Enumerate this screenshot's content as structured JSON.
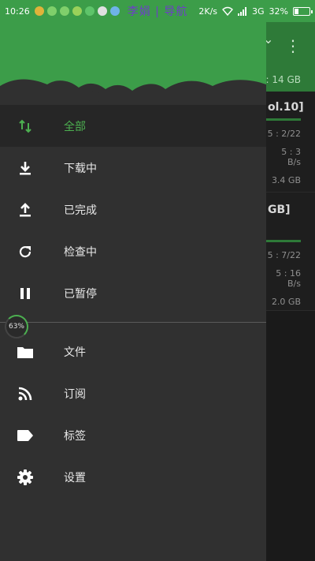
{
  "status_bar": {
    "time": "10:26",
    "overlay_text": "李娟 | 导航",
    "net_speed": "2K/s",
    "network": "3G",
    "battery_percent": "32%",
    "battery_level": 0.32
  },
  "background": {
    "toolbar_size": ": 14 GB",
    "cards": [
      {
        "title": "ol.10]",
        "progress": 0.8,
        "lines": [
          "5 : 2/22",
          "5 : 3 B/s",
          "3.4 GB"
        ]
      },
      {
        "title": "GB]",
        "progress": 0.8,
        "lines": [
          "5 : 7/22",
          "5 : 16 B/s",
          "2.0 GB"
        ]
      }
    ]
  },
  "drawer": {
    "progress_badge": "63%",
    "items": [
      {
        "label": "全部",
        "icon": "swap-vertical-icon",
        "active": true
      },
      {
        "label": "下载中",
        "icon": "download-icon",
        "active": false
      },
      {
        "label": "已完成",
        "icon": "upload-icon",
        "active": false
      },
      {
        "label": "检查中",
        "icon": "refresh-icon",
        "active": false
      },
      {
        "label": "已暂停",
        "icon": "pause-icon",
        "active": false
      }
    ],
    "items2": [
      {
        "label": "文件",
        "icon": "folder-icon"
      },
      {
        "label": "订阅",
        "icon": "rss-icon"
      },
      {
        "label": "标签",
        "icon": "label-icon"
      },
      {
        "label": "设置",
        "icon": "gear-icon"
      }
    ]
  },
  "colors": {
    "accent": "#4caf50",
    "header": "#3c9d49",
    "drawer_bg": "#303030"
  }
}
